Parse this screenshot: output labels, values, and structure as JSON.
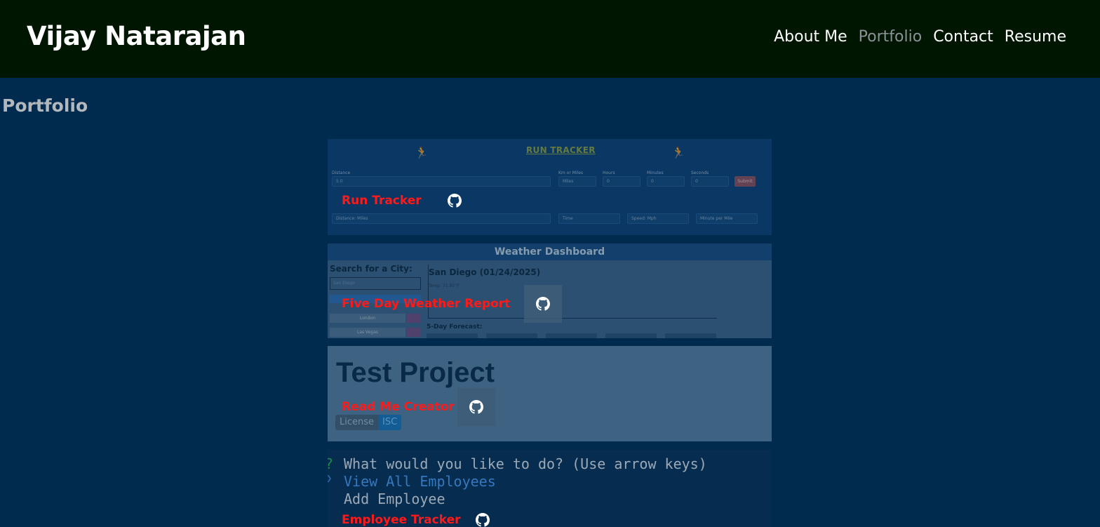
{
  "header": {
    "site_title": "Vijay Natarajan",
    "nav": [
      {
        "label": "About Me",
        "active": false
      },
      {
        "label": "Portfolio",
        "active": true
      },
      {
        "label": "Contact",
        "active": false
      },
      {
        "label": "Resume",
        "active": false
      }
    ]
  },
  "page": {
    "section_title": "Portfolio"
  },
  "projects": [
    {
      "name": "Run Tracker",
      "icon": "github-icon",
      "screenshot": {
        "title": "RUN TRACKER",
        "labels": [
          "Distance",
          "Km or Miles",
          "Hours",
          "Minutes",
          "Seconds"
        ],
        "fields": [
          "5.0",
          "Miles",
          "0",
          "0",
          "0"
        ],
        "submit": "Submit",
        "results": [
          "Distance: Miles",
          "Time",
          "Speed: Mph",
          "Minute per Mile"
        ]
      }
    },
    {
      "name": "Five Day Weather Report",
      "icon": "github-icon",
      "screenshot": {
        "header": "Weather Dashboard",
        "search_label": "Search for a City:",
        "search_placeholder": "San Diego",
        "cities": [
          "London",
          "Las Vegas"
        ],
        "current_city": "San Diego (01/24/2025)",
        "temp": "Temp: 71.92°F",
        "forecast_label": "5-Day Forecast:"
      }
    },
    {
      "name": "Read Me Creator",
      "icon": "github-icon",
      "screenshot": {
        "title": "Test Project",
        "badge_left": "License",
        "badge_right": "ISC"
      }
    },
    {
      "name": "Employee Tracker",
      "icon": "github-icon",
      "screenshot": {
        "prompt_mark": "?",
        "prompt": "What would you like to do? (Use arrow keys)",
        "selected": "View All Employees",
        "option": "Add Employee"
      }
    }
  ],
  "colors": {
    "header_bg": "#001600",
    "page_bg": "#002b4f",
    "project_name": "#ff1a1a",
    "nav_active": "#8a9197"
  }
}
